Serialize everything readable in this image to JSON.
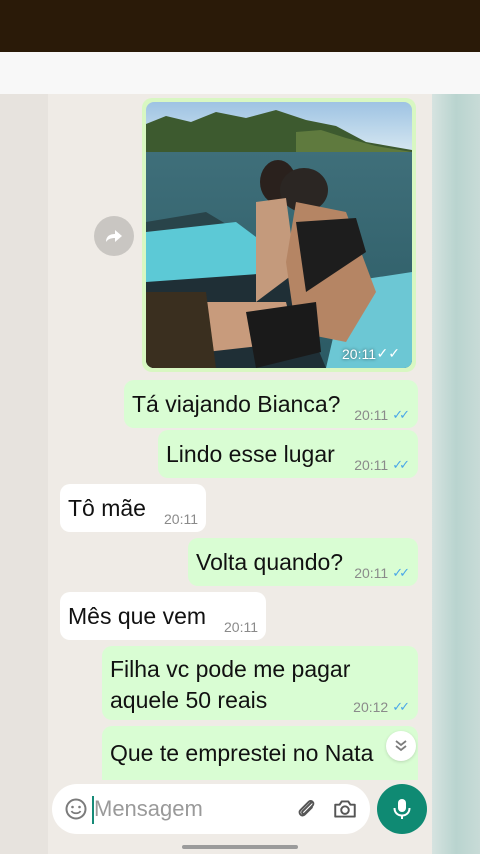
{
  "messages": [
    {
      "text": "Tá viajando Bianca?",
      "time": "20:11",
      "direction": "out"
    },
    {
      "text": "Lindo esse lugar",
      "time": "20:11",
      "direction": "out"
    },
    {
      "text": "Tô mãe",
      "time": "20:11",
      "direction": "in"
    },
    {
      "text": "Volta quando?",
      "time": "20:11",
      "direction": "out"
    },
    {
      "text": "Mês que vem",
      "time": "20:11",
      "direction": "in"
    },
    {
      "text": "Filha vc pode me pagar aquele 50 reais",
      "time": "20:12",
      "direction": "out"
    },
    {
      "text": "Que te emprestei no Nata",
      "direction": "out"
    }
  ],
  "photo_message": {
    "time": "20:11"
  },
  "input": {
    "placeholder": "Mensagem",
    "value": ""
  },
  "icons": {
    "forward": "forward-icon",
    "emoji": "emoji-icon",
    "attach": "paperclip-icon",
    "camera": "camera-icon",
    "mic": "mic-icon",
    "scroll": "double-chevron-down-icon",
    "ticks": "double-check-icon"
  },
  "colors": {
    "outgoing_bubble": "#d9fdd3",
    "incoming_bubble": "#ffffff",
    "chat_background": "#efebe6",
    "read_ticks": "#4aa7e8",
    "mic_button": "#0f8a73",
    "top_bar": "#2a1a08"
  }
}
